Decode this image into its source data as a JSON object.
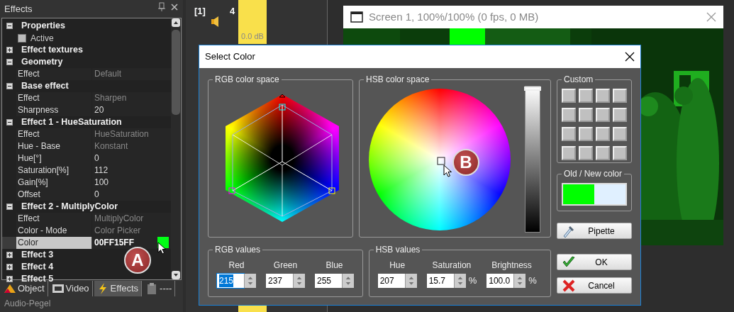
{
  "effects_panel": {
    "title": "Effects",
    "groups": [
      {
        "label": "Properties",
        "expanded": true,
        "rows": [
          {
            "kind": "checkbox",
            "label": "Active",
            "checked": false,
            "selected": false
          }
        ]
      },
      {
        "label": "Effect textures",
        "expanded": false
      },
      {
        "label": "Geometry",
        "expanded": true,
        "rows": [
          {
            "kind": "property",
            "label": "Effect",
            "value": "Default",
            "readonly": true,
            "selected": false
          }
        ]
      },
      {
        "label": "Base effect",
        "expanded": true,
        "rows": [
          {
            "kind": "property",
            "label": "Effect",
            "value": "Sharpen",
            "readonly": true,
            "selected": false
          },
          {
            "kind": "property",
            "label": "Sharpness",
            "value": "20",
            "readonly": false,
            "selected": false
          }
        ]
      },
      {
        "label": "Effect 1 - HueSaturation",
        "expanded": true,
        "rows": [
          {
            "kind": "property",
            "label": "Effect",
            "value": "HueSaturation",
            "readonly": true,
            "selected": false
          },
          {
            "kind": "property",
            "label": "Hue - Base",
            "value": "Konstant",
            "readonly": true,
            "selected": false
          },
          {
            "kind": "property",
            "label": "Hue[°]",
            "value": "0",
            "readonly": false,
            "selected": false
          },
          {
            "kind": "property",
            "label": "Saturation[%]",
            "value": "112",
            "readonly": false,
            "selected": false
          },
          {
            "kind": "property",
            "label": "Gain[%]",
            "value": "100",
            "readonly": false,
            "selected": false
          },
          {
            "kind": "property",
            "label": "Offset",
            "value": "0",
            "readonly": false,
            "selected": false
          }
        ]
      },
      {
        "label": "Effect 2 - MultiplyColor",
        "expanded": true,
        "rows": [
          {
            "kind": "property",
            "label": "Effect",
            "value": "MultiplyColor",
            "readonly": true,
            "selected": false
          },
          {
            "kind": "property",
            "label": "Color - Mode",
            "value": "Color Picker",
            "readonly": true,
            "selected": false
          },
          {
            "kind": "color",
            "label": "Color",
            "value": "00FF15FF",
            "color": "#00ff15",
            "readonly": false,
            "selected": true
          }
        ]
      },
      {
        "label": "Effect 3",
        "expanded": false
      },
      {
        "label": "Effect 4",
        "expanded": false
      },
      {
        "label": "Effect 5",
        "expanded": false
      }
    ],
    "tabs": [
      {
        "label": "Object",
        "selected": false
      },
      {
        "label": "Video",
        "selected": false
      },
      {
        "label": "Effects",
        "selected": true
      },
      {
        "label": "----",
        "selected": false
      }
    ],
    "next_panel_title": "Audio-Pegel"
  },
  "mixer": {
    "channel": "[1]",
    "number": "4",
    "reading": "0.0 dB"
  },
  "screen_window": {
    "title": "Screen 1, 100%/100% (0 fps, 0 MB)"
  },
  "dialog": {
    "title": "Select Color",
    "rgb_space": {
      "title": "RGB color space"
    },
    "hsb_space": {
      "title": "HSB color space",
      "brightness": {
        "level": 1
      }
    },
    "custom": {
      "title": "Custom"
    },
    "old_new": {
      "title": "Old / New color",
      "swatches": [
        {
          "color": "#00ff00"
        },
        {
          "color": "#e0f0ff"
        }
      ]
    },
    "rgb_values": {
      "title": "RGB values",
      "fields": [
        {
          "label": "Red",
          "value": "215",
          "focused": true
        },
        {
          "label": "Green",
          "value": "237",
          "focused": false
        },
        {
          "label": "Blue",
          "value": "255",
          "focused": false
        }
      ]
    },
    "hsb_values": {
      "title": "HSB values",
      "fields": [
        {
          "label": "Hue",
          "value": "207",
          "focused": false
        },
        {
          "label": "Saturation",
          "value": "15.7",
          "unit": "%",
          "focused": false
        },
        {
          "label": "Brightness",
          "value": "100.0",
          "unit": "%",
          "focused": false
        }
      ]
    },
    "buttons": [
      {
        "kind": "pipette",
        "label": "Pipette"
      },
      {
        "kind": "ok",
        "label": "OK"
      },
      {
        "kind": "cancel",
        "label": "Cancel"
      }
    ]
  },
  "callouts": [
    {
      "label": "A"
    },
    {
      "label": "B"
    }
  ]
}
